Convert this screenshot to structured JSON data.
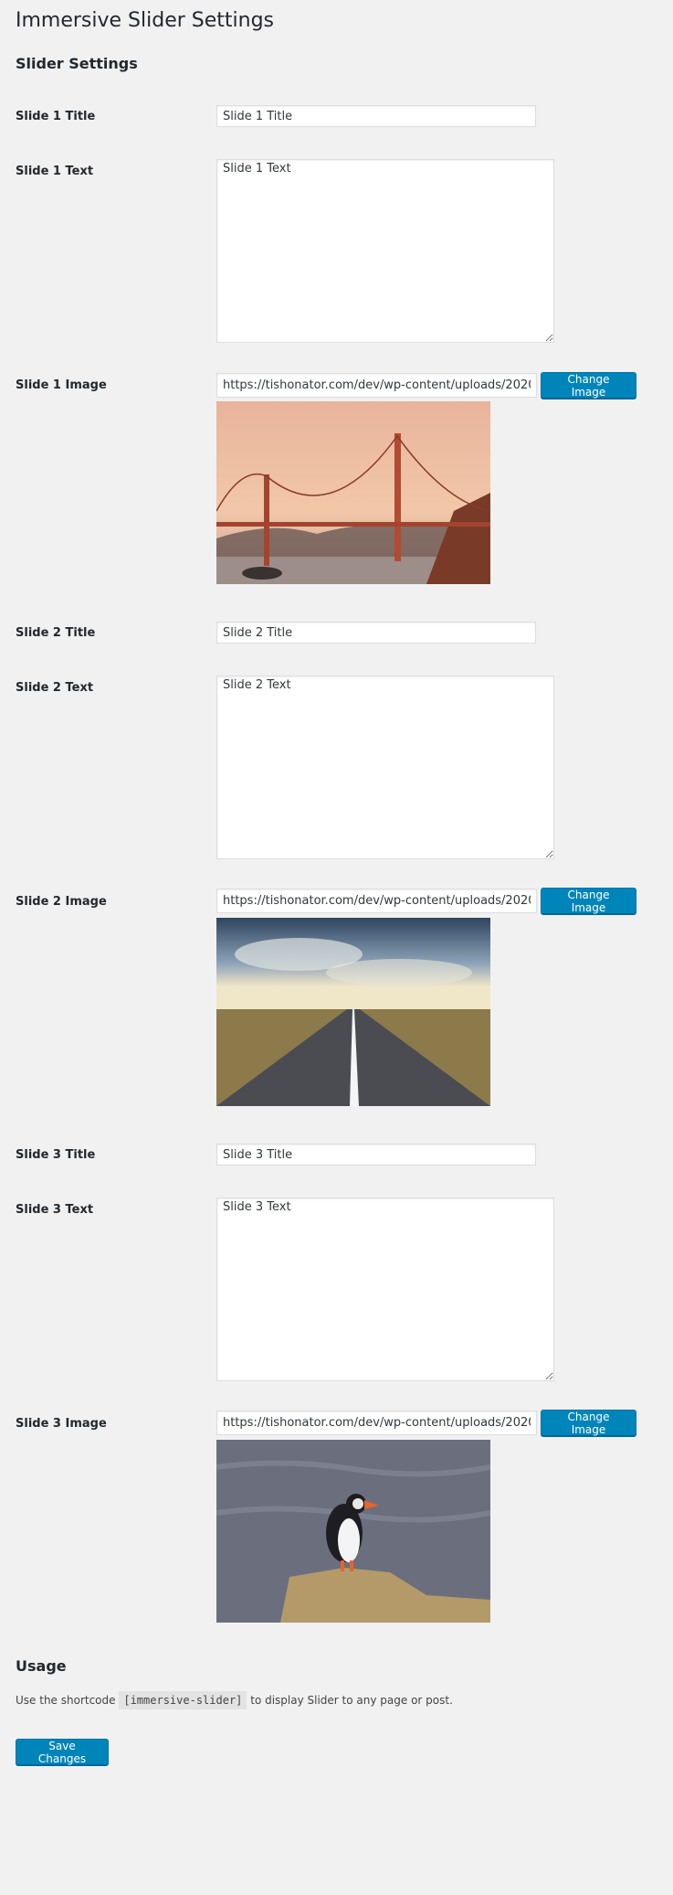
{
  "page": {
    "title": "Immersive Slider Settings"
  },
  "settings": {
    "heading": "Slider Settings",
    "slides": [
      {
        "title_label": "Slide 1 Title",
        "title_value": "Slide 1 Title",
        "text_label": "Slide 1 Text",
        "text_value": "Slide 1 Text",
        "image_label": "Slide 1 Image",
        "image_url": "https://tishonator.com/dev/wp-content/uploads/2020/",
        "change_label": "Change Image",
        "image_subject": "golden-gate-bridge-at-sunset"
      },
      {
        "title_label": "Slide 2 Title",
        "title_value": "Slide 2 Title",
        "text_label": "Slide 2 Text",
        "text_value": "Slide 2 Text",
        "image_label": "Slide 2 Image",
        "image_url": "https://tishonator.com/dev/wp-content/uploads/2020/",
        "change_label": "Change Image",
        "image_subject": "empty-road-under-cloudy-sky"
      },
      {
        "title_label": "Slide 3 Title",
        "title_value": "Slide 3 Title",
        "text_label": "Slide 3 Text",
        "text_value": "Slide 3 Text",
        "image_label": "Slide 3 Image",
        "image_url": "https://tishonator.com/dev/wp-content/uploads/2020/",
        "change_label": "Change Image",
        "image_subject": "puffin-on-rock"
      }
    ]
  },
  "usage": {
    "heading": "Usage",
    "text_before": "Use the shortcode",
    "shortcode": "[immersive-slider]",
    "text_after": "to display Slider to any page or post."
  },
  "actions": {
    "save_label": "Save Changes"
  },
  "colors": {
    "primary_button": "#0085ba",
    "background": "#f1f1f1"
  }
}
